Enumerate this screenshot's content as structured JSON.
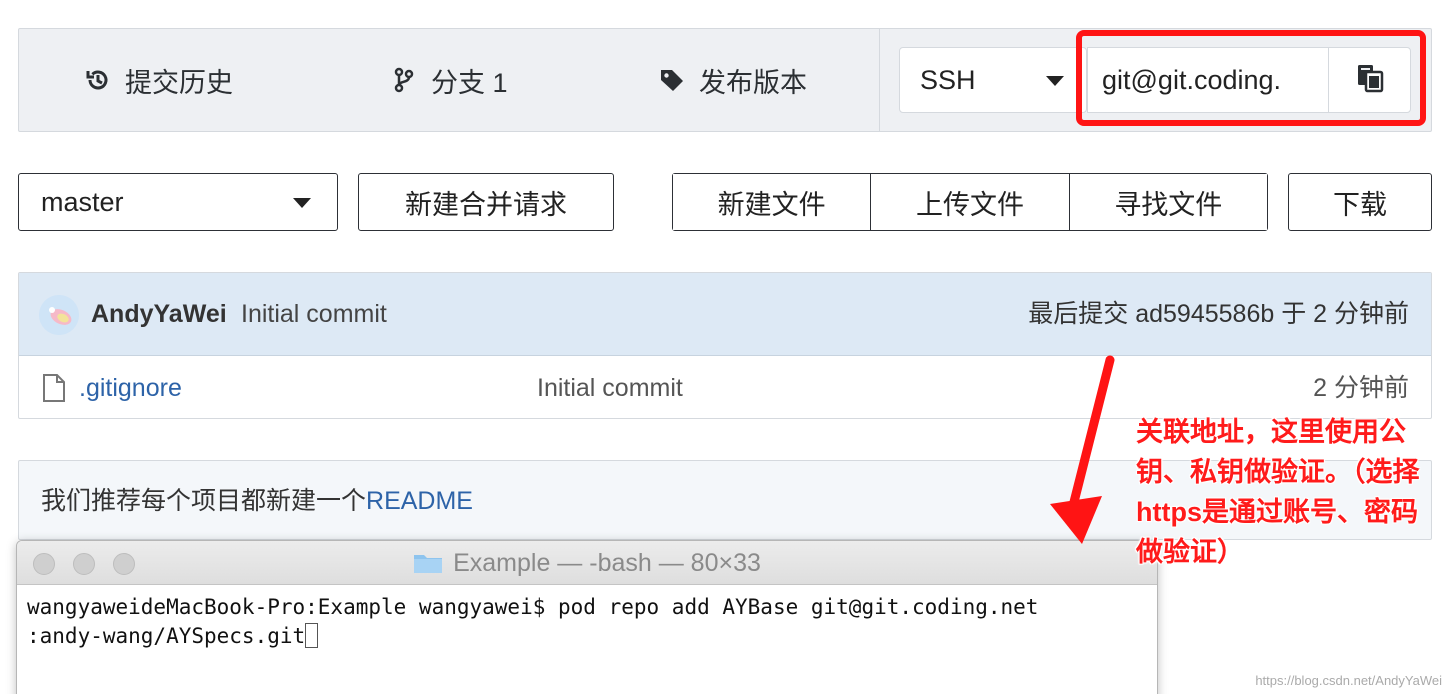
{
  "top_nav": {
    "commit_history": "提交历史",
    "branches": "分支 1",
    "releases": "发布版本"
  },
  "clone": {
    "protocol": "SSH",
    "url": "git@git.coding."
  },
  "branch_row": {
    "branch": "master",
    "new_merge_request": "新建合并请求",
    "new_file": "新建文件",
    "upload_file": "上传文件",
    "find_file": "寻找文件",
    "download": "下载"
  },
  "commit_header": {
    "author": "AndyYaWei",
    "message": "Initial commit",
    "last_commit": "最后提交 ad5945586b 于 2 分钟前"
  },
  "files": [
    {
      "name": ".gitignore",
      "message": "Initial commit",
      "time": "2 分钟前"
    }
  ],
  "readme": {
    "prefix": "我们推荐每个项目都新建一个",
    "link": "README"
  },
  "terminal": {
    "title": "Example — -bash — 80×33",
    "line1": "wangyaweideMacBook-Pro:Example wangyawei$ pod repo add AYBase git@git.coding.net",
    "line2": ":andy-wang/AYSpecs.git"
  },
  "annotation": "关联地址，这里使用公钥、私钥做验证。（选择https是通过账号、密码做验证）",
  "watermark": "https://blog.csdn.net/AndyYaWei",
  "colors": {
    "highlight": "#ff1414",
    "link": "#2d63a8",
    "header_bg": "#dde9f5"
  },
  "icons": {
    "commit_history": "history-icon",
    "branches": "branch-icon",
    "releases": "tag-icon",
    "copy": "copy-icon",
    "file": "file-icon",
    "folder": "folder-icon"
  }
}
